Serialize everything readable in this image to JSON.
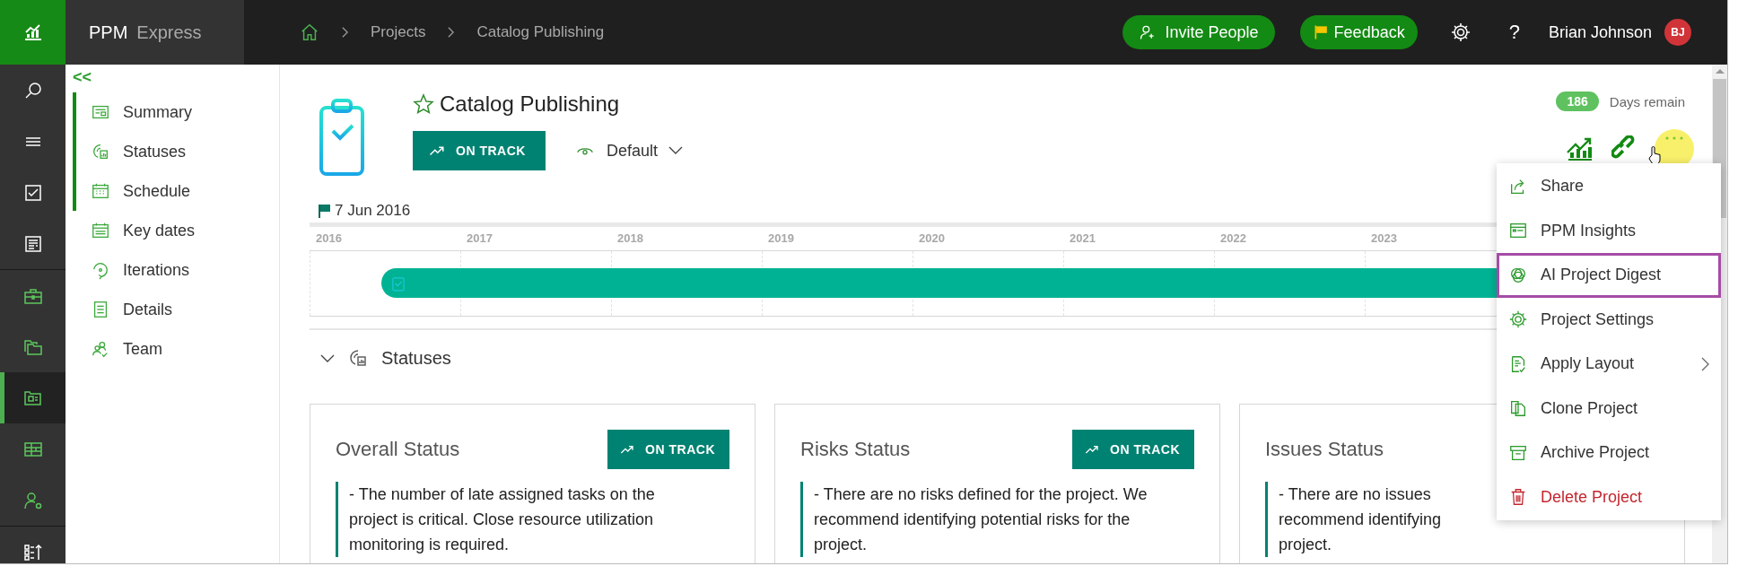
{
  "topbar": {
    "brand": "PPM",
    "product": "Express",
    "breadcrumb": [
      "Projects",
      "Catalog Publishing"
    ],
    "invite": "Invite People",
    "feedback": "Feedback",
    "help": "?",
    "user": {
      "name": "Brian Johnson",
      "initials": "BJ"
    }
  },
  "rail": {
    "groups": [
      {
        "items": [
          {
            "kind": "search",
            "selected": false
          },
          {
            "kind": "menu",
            "selected": false
          },
          {
            "kind": "tasks",
            "selected": false
          },
          {
            "kind": "report",
            "selected": false
          }
        ]
      },
      {
        "items": [
          {
            "kind": "portfolio",
            "selected": false
          },
          {
            "kind": "folders",
            "selected": false
          },
          {
            "kind": "project",
            "selected": true
          },
          {
            "kind": "grid",
            "selected": false
          },
          {
            "kind": "user-settings",
            "selected": false
          }
        ]
      },
      {
        "items": [
          {
            "kind": "priorities",
            "selected": false
          }
        ]
      }
    ]
  },
  "sections": {
    "collapse": "<<",
    "items": [
      {
        "label": "Summary",
        "kind": "summary",
        "in_view": true
      },
      {
        "label": "Statuses",
        "kind": "statuses",
        "in_view": true
      },
      {
        "label": "Schedule",
        "kind": "schedule",
        "in_view": true
      },
      {
        "label": "Key dates",
        "kind": "key-dates",
        "in_view": false
      },
      {
        "label": "Iterations",
        "kind": "iterations",
        "in_view": false
      },
      {
        "label": "Details",
        "kind": "details",
        "in_view": false
      },
      {
        "label": "Team",
        "kind": "team",
        "in_view": false
      }
    ]
  },
  "project": {
    "title": "Catalog Publishing",
    "starred": false,
    "status": "ON TRACK",
    "view": "Default",
    "days_count": "186",
    "days_label": "Days remain"
  },
  "timeline": {
    "start_date": "7 Jun 2016",
    "years": [
      "2016",
      "2017",
      "2018",
      "2019",
      "2020",
      "2021",
      "2022",
      "2023"
    ]
  },
  "statuses_section": {
    "title": "Statuses",
    "expanded": true
  },
  "status_cards": [
    {
      "title": "Overall Status",
      "status": "ON TRACK",
      "lines": [
        "- The number of late assigned tasks on the",
        "project is critical. Close resource utilization",
        "monitoring is required."
      ]
    },
    {
      "title": "Risks Status",
      "status": "ON TRACK",
      "lines": [
        "- There are no risks defined for the project. We",
        "recommend identifying potential risks for the",
        "project."
      ]
    },
    {
      "title": "Issues Status",
      "lines": [
        "- There are no issues",
        "recommend identifying",
        "project."
      ]
    }
  ],
  "menu": [
    {
      "label": "Share",
      "kind": "share",
      "highlighted": false,
      "danger": false,
      "submenu": false
    },
    {
      "label": "PPM Insights",
      "kind": "insights",
      "highlighted": false,
      "danger": false,
      "submenu": false
    },
    {
      "label": "AI Project Digest",
      "kind": "ai",
      "highlighted": true,
      "danger": false,
      "submenu": false
    },
    {
      "label": "Project Settings",
      "kind": "settings",
      "highlighted": false,
      "danger": false,
      "submenu": false
    },
    {
      "label": "Apply Layout",
      "kind": "layout",
      "highlighted": false,
      "danger": false,
      "submenu": true
    },
    {
      "label": "Clone Project",
      "kind": "clone",
      "highlighted": false,
      "danger": false,
      "submenu": false
    },
    {
      "label": "Archive Project",
      "kind": "archive",
      "highlighted": false,
      "danger": false,
      "submenu": false
    },
    {
      "label": "Delete Project",
      "kind": "delete",
      "highlighted": false,
      "danger": true,
      "submenu": false
    }
  ]
}
